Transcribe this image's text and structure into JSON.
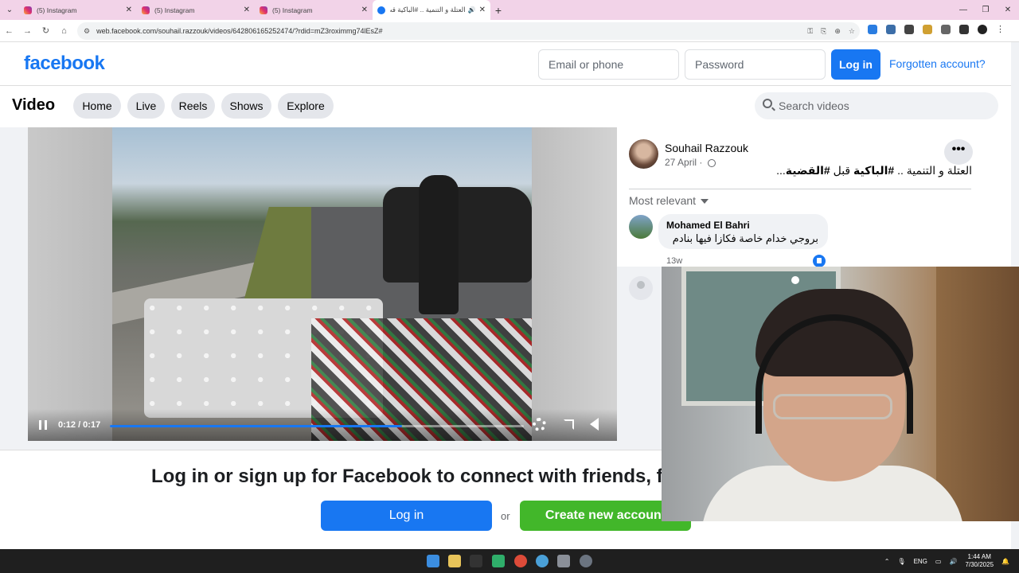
{
  "browser": {
    "tabs": [
      {
        "label": "(5) Instagram",
        "type": "instagram",
        "active": false
      },
      {
        "label": "(5) Instagram",
        "type": "instagram",
        "active": false
      },
      {
        "label": "(5) Instagram",
        "type": "instagram",
        "active": false
      },
      {
        "label": "العتلة و التنمية .. #الباكية قب",
        "type": "facebook",
        "active": true
      }
    ],
    "new_tab": "+",
    "url": "web.facebook.com/souhail.razzouk/videos/642806165252474/?rdid=mZ3roximmg74lEsZ#"
  },
  "header": {
    "logo": "facebook",
    "email_placeholder": "Email or phone",
    "password_placeholder": "Password",
    "login_label": "Log in",
    "forgot_label": "Forgotten account?"
  },
  "video_nav": {
    "title": "Video",
    "items": [
      "Home",
      "Live",
      "Reels",
      "Shows",
      "Explore"
    ],
    "search_placeholder": "Search videos"
  },
  "player": {
    "time": "0:12 / 0:17",
    "progress": 0.706
  },
  "post": {
    "author": "Souhail Razzouk",
    "date": "27 April ·",
    "caption_plain_1": "العتلة و التنمية .. ",
    "caption_tag_1": "#الباكية",
    "caption_plain_2": " قبل ",
    "caption_tag_2": "#القضية",
    "caption_plain_3": "...",
    "sort_label": "Most relevant",
    "comment": {
      "author": "Mohamed El Bahri",
      "text": "بروجي خدام خاصة فكازا فيها بنادم",
      "time": "13w"
    }
  },
  "login_banner": {
    "text": "Log in or sign up for Facebook to connect with friends, family",
    "login_label": "Log in",
    "or": "or",
    "create_label": "Create new account"
  },
  "taskbar": {
    "lang": "ENG",
    "time": "1:44 AM",
    "date": "7/30/2025"
  }
}
